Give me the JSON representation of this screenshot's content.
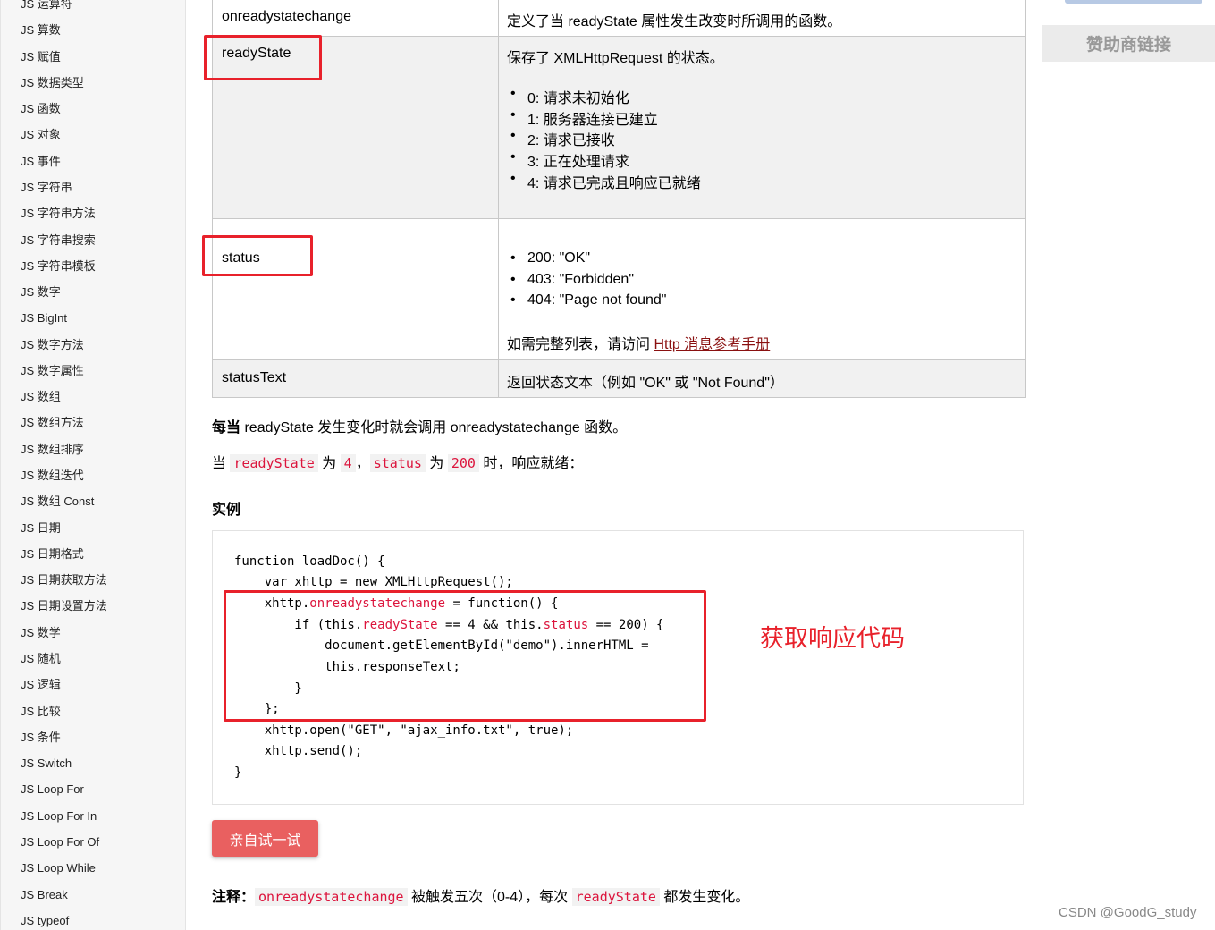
{
  "sidebar": {
    "items": [
      "JS 运算符",
      "JS 算数",
      "JS 赋值",
      "JS 数据类型",
      "JS 函数",
      "JS 对象",
      "JS 事件",
      "JS 字符串",
      "JS 字符串方法",
      "JS 字符串搜索",
      "JS 字符串模板",
      "JS 数字",
      "JS BigInt",
      "JS 数字方法",
      "JS 数字属性",
      "JS 数组",
      "JS 数组方法",
      "JS 数组排序",
      "JS 数组迭代",
      "JS 数组 Const",
      "JS 日期",
      "JS 日期格式",
      "JS 日期获取方法",
      "JS 日期设置方法",
      "JS 数学",
      "JS 随机",
      "JS 逻辑",
      "JS 比较",
      "JS 条件",
      "JS Switch",
      "JS Loop For",
      "JS Loop For In",
      "JS Loop For Of",
      "JS Loop While",
      "JS Break",
      "JS typeof"
    ]
  },
  "table": {
    "row1": {
      "property": "onreadystatechange",
      "description": "定义了当 readyState 属性发生改变时所调用的函数。"
    },
    "row2": {
      "property": "readyState",
      "description": "保存了 XMLHttpRequest 的状态。",
      "items": [
        "0: 请求未初始化",
        "1: 服务器连接已建立",
        "2: 请求已接收",
        "3: 正在处理请求",
        "4: 请求已完成且响应已就绪"
      ]
    },
    "row3": {
      "property": "status",
      "items": [
        "200: \"OK\"",
        "403: \"Forbidden\"",
        "404: \"Page not found\""
      ],
      "note_prefix": "如需完整列表，请访问 ",
      "note_link": "Http 消息参考手册"
    },
    "row4": {
      "property": "statusText",
      "description": "返回状态文本（例如 \"OK\" 或 \"Not Found\"）"
    }
  },
  "para1": {
    "bold": "每当",
    "rest": " readyState 发生变化时就会调用 onreadystatechange 函数。"
  },
  "para2": {
    "t1": "当 ",
    "c1": "readyState",
    "t2": " 为 ",
    "c2": "4",
    "t3": "，",
    "c3": "status",
    "t4": " 为 ",
    "c4": "200",
    "t5": " 时，响应就绪："
  },
  "example_title": "实例",
  "code": {
    "l1": "function loadDoc() {",
    "l2": "    var xhttp = new XMLHttpRequest();",
    "l3a": "    xhttp.",
    "l3b": "onreadystatechange",
    "l3c": " = function() {",
    "l4a": "        if (this.",
    "l4b": "readyState",
    "l4c": " == 4 && this.",
    "l4d": "status",
    "l4e": " == 200) {",
    "l5": "            document.getElementById(\"demo\").innerHTML =",
    "l6": "            this.responseText;",
    "l7": "        }",
    "l8": "    };",
    "l9": "    xhttp.open(\"GET\", \"ajax_info.txt\", true);",
    "l10": "    xhttp.send();",
    "l11": "}"
  },
  "annotation": "获取响应代码",
  "try_button": "亲自试一试",
  "note": {
    "bold": "注释：",
    "c1": "onreadystatechange",
    "t1": " 被触发五次（0-4），每次 ",
    "c2": "readyState",
    "t2": " 都发生变化。"
  },
  "right": {
    "sponsor": "赞助商链接"
  },
  "watermark": "CSDN @GoodG_study"
}
